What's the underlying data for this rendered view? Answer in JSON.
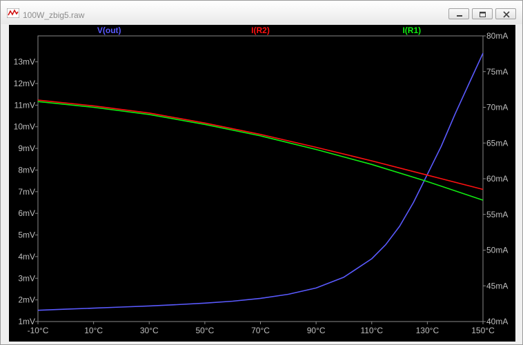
{
  "window": {
    "title": "100W_zbig5.raw",
    "controls": {
      "minimize": "minimize-icon",
      "restore": "restore-icon",
      "close": "close-icon"
    }
  },
  "colors": {
    "background": "#000000",
    "axis": "#8a8a8a",
    "tick_label": "#bfbfbf",
    "vout": "#5a5aff",
    "ir2": "#ff1010",
    "ir1": "#10ee10"
  },
  "chart_data": {
    "type": "line",
    "xlabel_ticks": [
      "-10°C",
      "10°C",
      "30°C",
      "50°C",
      "70°C",
      "90°C",
      "110°C",
      "130°C",
      "150°C"
    ],
    "x_ticks": [
      -10,
      10,
      30,
      50,
      70,
      90,
      110,
      130,
      150
    ],
    "xlim": [
      -10,
      150
    ],
    "y_left": {
      "ticks": [
        1,
        2,
        3,
        4,
        5,
        6,
        7,
        8,
        9,
        10,
        11,
        12,
        13
      ],
      "tick_labels": [
        "1mV",
        "2mV",
        "3mV",
        "4mV",
        "5mV",
        "6mV",
        "7mV",
        "8mV",
        "9mV",
        "10mV",
        "11mV",
        "12mV",
        "13mV"
      ],
      "lim": [
        1,
        14.2
      ]
    },
    "y_right": {
      "ticks": [
        40,
        45,
        50,
        55,
        60,
        65,
        70,
        75,
        80
      ],
      "tick_labels": [
        "40mA",
        "45mA",
        "50mA",
        "55mA",
        "60mA",
        "65mA",
        "70mA",
        "75mA",
        "80mA"
      ],
      "lim": [
        40,
        80
      ]
    },
    "series": [
      {
        "name": "V(out)",
        "axis": "left",
        "color": "#5a5aff",
        "x": [
          -10,
          0,
          10,
          20,
          30,
          40,
          50,
          60,
          70,
          80,
          90,
          100,
          110,
          115,
          120,
          125,
          130,
          135,
          140,
          145,
          150
        ],
        "y": [
          1.52,
          1.57,
          1.62,
          1.67,
          1.72,
          1.78,
          1.85,
          1.94,
          2.07,
          2.26,
          2.55,
          3.05,
          3.9,
          4.55,
          5.4,
          6.5,
          7.8,
          9.1,
          10.6,
          12.0,
          13.4
        ]
      },
      {
        "name": "I(R2)",
        "axis": "right",
        "color": "#ff1010",
        "x": [
          -10,
          10,
          30,
          50,
          70,
          90,
          110,
          130,
          150
        ],
        "y": [
          71.0,
          70.2,
          69.2,
          67.8,
          66.2,
          64.4,
          62.5,
          60.5,
          58.5
        ]
      },
      {
        "name": "I(R1)",
        "axis": "right",
        "color": "#10ee10",
        "x": [
          -10,
          10,
          30,
          50,
          70,
          90,
          110,
          130,
          150
        ],
        "y": [
          70.8,
          70.0,
          69.0,
          67.6,
          66.0,
          64.1,
          62.0,
          59.6,
          57.0
        ]
      }
    ]
  }
}
